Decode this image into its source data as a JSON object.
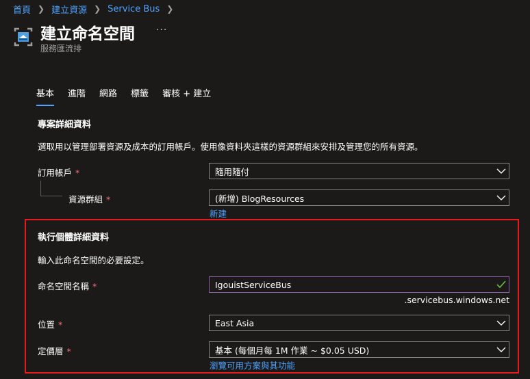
{
  "breadcrumb": [
    "首頁",
    "建立資源",
    "Service Bus"
  ],
  "header": {
    "title": "建立命名空間",
    "more": "···",
    "subtitle": "服務匯流排"
  },
  "tabs": [
    {
      "label": "基本",
      "active": true
    },
    {
      "label": "進階"
    },
    {
      "label": "網路"
    },
    {
      "label": "標籤"
    },
    {
      "label": "審核 + 建立"
    }
  ],
  "project": {
    "title": "專案詳細資料",
    "description": "選取用以管理部署資源及成本的訂用帳戶。使用像資料夾這樣的資源群組來安排及管理您的所有資源。",
    "subscription_label": "訂用帳戶",
    "subscription_value": "隨用隨付",
    "resource_group_label": "資源群組",
    "resource_group_value": "(新增) BlogResources",
    "create_new_link": "新建"
  },
  "instance": {
    "title": "執行個體詳細資料",
    "description": "輸入此命名空間的必要設定。",
    "namespace_label": "命名空間名稱",
    "namespace_value": "IgouistServiceBus",
    "namespace_suffix": ".servicebus.windows.net",
    "location_label": "位置",
    "location_value": "East Asia",
    "pricing_label": "定價層",
    "pricing_value": "基本 (每個月每 1M 作業 ~ $0.05 USD)",
    "browse_link": "瀏覽可用方案與其功能"
  },
  "required_marker": "*",
  "colors": {
    "background": "#1b1a19",
    "link": "#4fa3ff",
    "required": "#f1707b",
    "highlight_box": "#e8191f",
    "valid_check": "#6cbf43"
  },
  "icons": {
    "header": "service-bus-icon",
    "dropdown": "chevron-down-icon",
    "valid": "checkmark-icon"
  }
}
